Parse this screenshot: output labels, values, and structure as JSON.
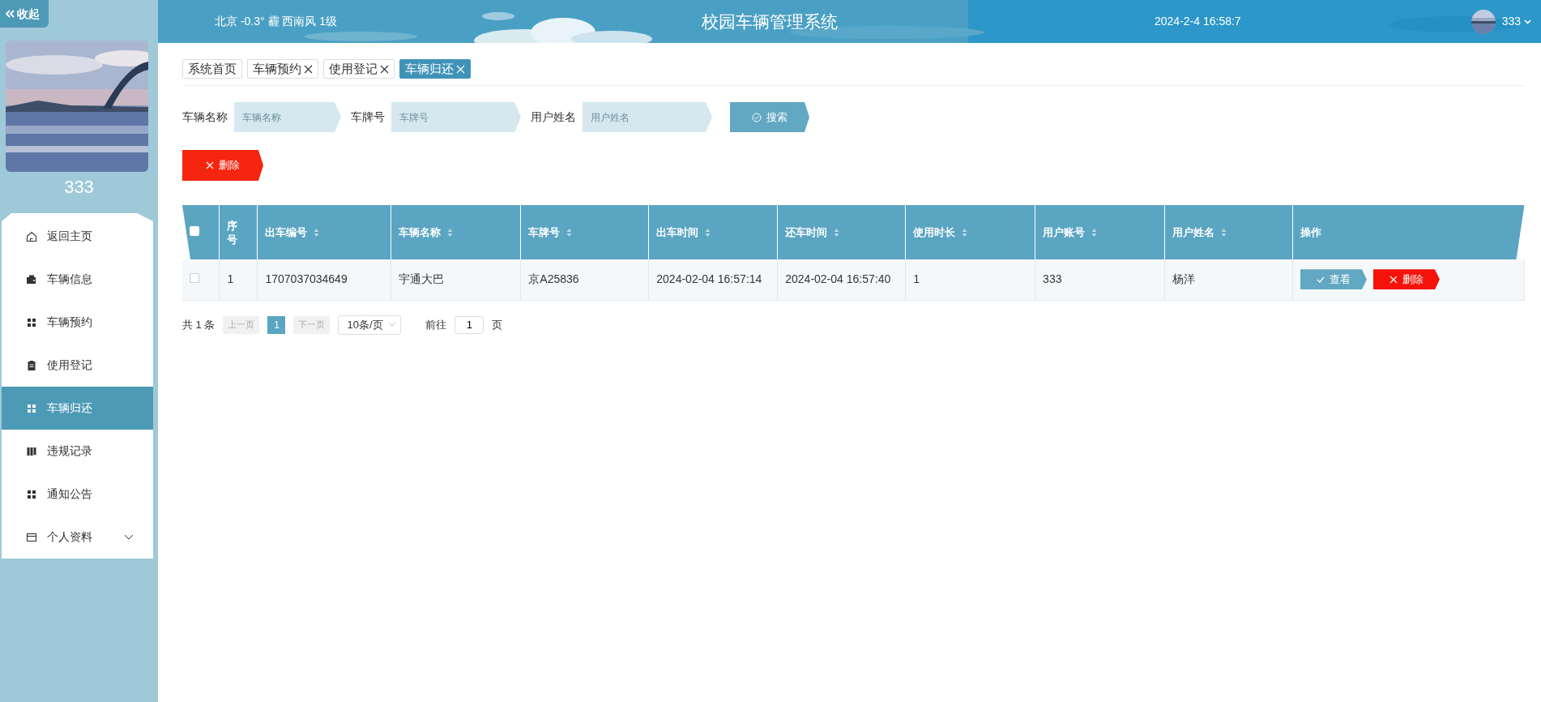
{
  "sidebar": {
    "collapse_label": "收起",
    "username": "333",
    "items": [
      {
        "label": "返回主页",
        "selected": false
      },
      {
        "label": "车辆信息",
        "selected": false
      },
      {
        "label": "车辆预约",
        "selected": false
      },
      {
        "label": "使用登记",
        "selected": false
      },
      {
        "label": "车辆归还",
        "selected": true
      },
      {
        "label": "违规记录",
        "selected": false
      },
      {
        "label": "通知公告",
        "selected": false
      },
      {
        "label": "个人资料",
        "selected": false,
        "expanded": false
      }
    ]
  },
  "header": {
    "weather": "北京  -0.3°  霾  西南风  1级",
    "title": "校园车辆管理系统",
    "datetime": "2024-2-4 16:58:7",
    "user": "333"
  },
  "tabs": [
    {
      "label": "系统首页",
      "closable": false,
      "selected": false
    },
    {
      "label": "车辆预约",
      "closable": true,
      "selected": false
    },
    {
      "label": "使用登记",
      "closable": true,
      "selected": false
    },
    {
      "label": "车辆归还",
      "closable": true,
      "selected": true
    }
  ],
  "filters": [
    {
      "label": "车辆名称",
      "placeholder": "车辆名称"
    },
    {
      "label": "车牌号",
      "placeholder": "车牌号"
    },
    {
      "label": "用户姓名",
      "placeholder": "用户姓名"
    }
  ],
  "search_button": "搜索",
  "delete_button": "删除",
  "table": {
    "select_all_checked": false,
    "columns": [
      {
        "label": "序号",
        "sortable": false
      },
      {
        "label": "出车编号",
        "sortable": true
      },
      {
        "label": "车辆名称",
        "sortable": true
      },
      {
        "label": "车牌号",
        "sortable": true
      },
      {
        "label": "出车时间",
        "sortable": true
      },
      {
        "label": "还车时间",
        "sortable": true
      },
      {
        "label": "使用时长",
        "sortable": true
      },
      {
        "label": "用户账号",
        "sortable": true
      },
      {
        "label": "用户姓名",
        "sortable": true
      },
      {
        "label": "操作",
        "sortable": false
      }
    ],
    "rows": [
      {
        "selected": false,
        "cells": [
          "1",
          "1707037034649",
          "宇通大巴",
          "京A25836",
          "2024-02-04 16:57:14",
          "2024-02-04 16:57:40",
          "1",
          "333",
          "杨洋"
        ],
        "actions": [
          {
            "label": "查看",
            "kind": "view"
          },
          {
            "label": "删除",
            "kind": "delete"
          }
        ]
      }
    ]
  },
  "pagination": {
    "total": "共 1 条",
    "prev": "上一页",
    "pages": [
      {
        "label": "1",
        "selected": true
      }
    ],
    "next": "下一页",
    "page_size": "10条/页",
    "goto_label": "前往",
    "goto_value": "1",
    "goto_suffix": "页"
  }
}
